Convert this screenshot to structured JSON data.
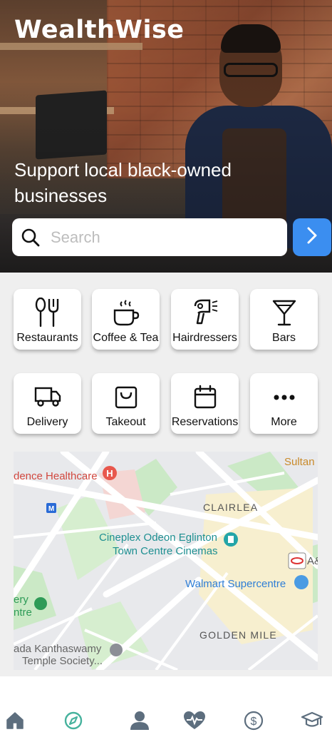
{
  "app": {
    "title": "WealthWise",
    "tagline": "Support local black-owned businesses"
  },
  "search": {
    "placeholder": "Search",
    "value": ""
  },
  "categories": [
    {
      "label": "Restaurants",
      "icon": "fork-spoon-icon"
    },
    {
      "label": "Coffee & Tea",
      "icon": "coffee-cup-icon"
    },
    {
      "label": "Hairdressers",
      "icon": "hair-dryer-icon"
    },
    {
      "label": "Bars",
      "icon": "cocktail-glass-icon"
    },
    {
      "label": "Delivery",
      "icon": "delivery-truck-icon"
    },
    {
      "label": "Takeout",
      "icon": "shopping-bag-icon"
    },
    {
      "label": "Reservations",
      "icon": "calendar-icon"
    },
    {
      "label": "More",
      "icon": "more-dots-icon"
    }
  ],
  "map": {
    "labels": {
      "healthcare": "dence Healthcare",
      "sultan": "Sultan",
      "clairlea": "CLAIRLEA",
      "cinema1": "Cineplex Odeon Eglinton",
      "cinema2": "Town Centre Cinemas",
      "walmart": "Walmart Supercentre",
      "golden_mile": "GOLDEN MILE",
      "temple1": "ada Kanthaswamy",
      "temple2": "Temple Society...",
      "ery": "ery",
      "ntre": "ntre",
      "a8": "A&"
    }
  },
  "tabs": [
    {
      "name": "home",
      "icon": "home-icon"
    },
    {
      "name": "explore",
      "icon": "compass-icon",
      "active": true
    },
    {
      "name": "profile",
      "icon": "person-icon"
    },
    {
      "name": "health",
      "icon": "heart-pulse-icon"
    },
    {
      "name": "finance",
      "icon": "dollar-circle-icon"
    },
    {
      "name": "education",
      "icon": "graduation-cap-icon"
    }
  ],
  "colors": {
    "accent": "#3b8ef0",
    "active_tab": "#46b29d",
    "tab_icon": "#5d6e7e",
    "background": "#efefef"
  }
}
